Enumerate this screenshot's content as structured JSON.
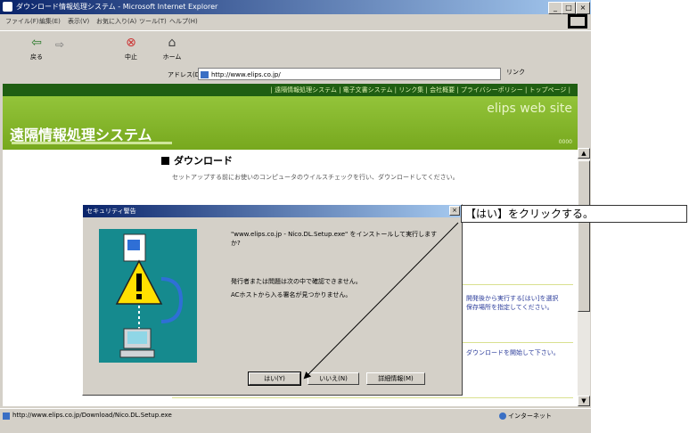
{
  "window": {
    "title": "ダウンロード情報処理システム - Microsoft Internet Explorer"
  },
  "menu": [
    "ファイル(F)",
    "編集(E)",
    "表示(V)",
    "お気に入り(A)",
    "ツール(T)",
    "ヘルプ(H)"
  ],
  "toolbar": {
    "back": "戻る",
    "stop": "中止",
    "home": "ホーム"
  },
  "address": {
    "label": "アドレス(D)",
    "url": "http://www.elips.co.jp/",
    "go": "リンク"
  },
  "page": {
    "nav": "| 遠隔情報処理システム | 電子文書システム | リンク集 | 会社概要 | プライバシーポリシー | トップページ |",
    "site_name": "elips web site",
    "brand": "遠隔情報処理システム",
    "heading": "ダウンロード",
    "intro": "セットアップする前にお使いのコンピュータのウイルスチェックを行い、ダウンロードしてください。",
    "side1": "開発後から実行する[はい]を選択",
    "side2": "保存場所を指定してください。",
    "side3": "ダウンロードを開始して下さい。"
  },
  "status": {
    "text": "http://www.elips.co.jp/Download/Nico.DL.Setup.exe",
    "zone": "インターネット"
  },
  "dialog": {
    "title": "セキュリティ警告",
    "message1": "\"www.elips.co.jp - Nico.DL.Setup.exe\" をインストールして実行しますか?",
    "message2": "発行者または問題は次の中で確認できません。",
    "message3": "ACホストから入る署名が見つかりません。",
    "btn_yes": "はい(Y)",
    "btn_no": "いいえ(N)",
    "btn_info": "詳細情報(M)"
  },
  "callout": "【はい】をクリックする。"
}
